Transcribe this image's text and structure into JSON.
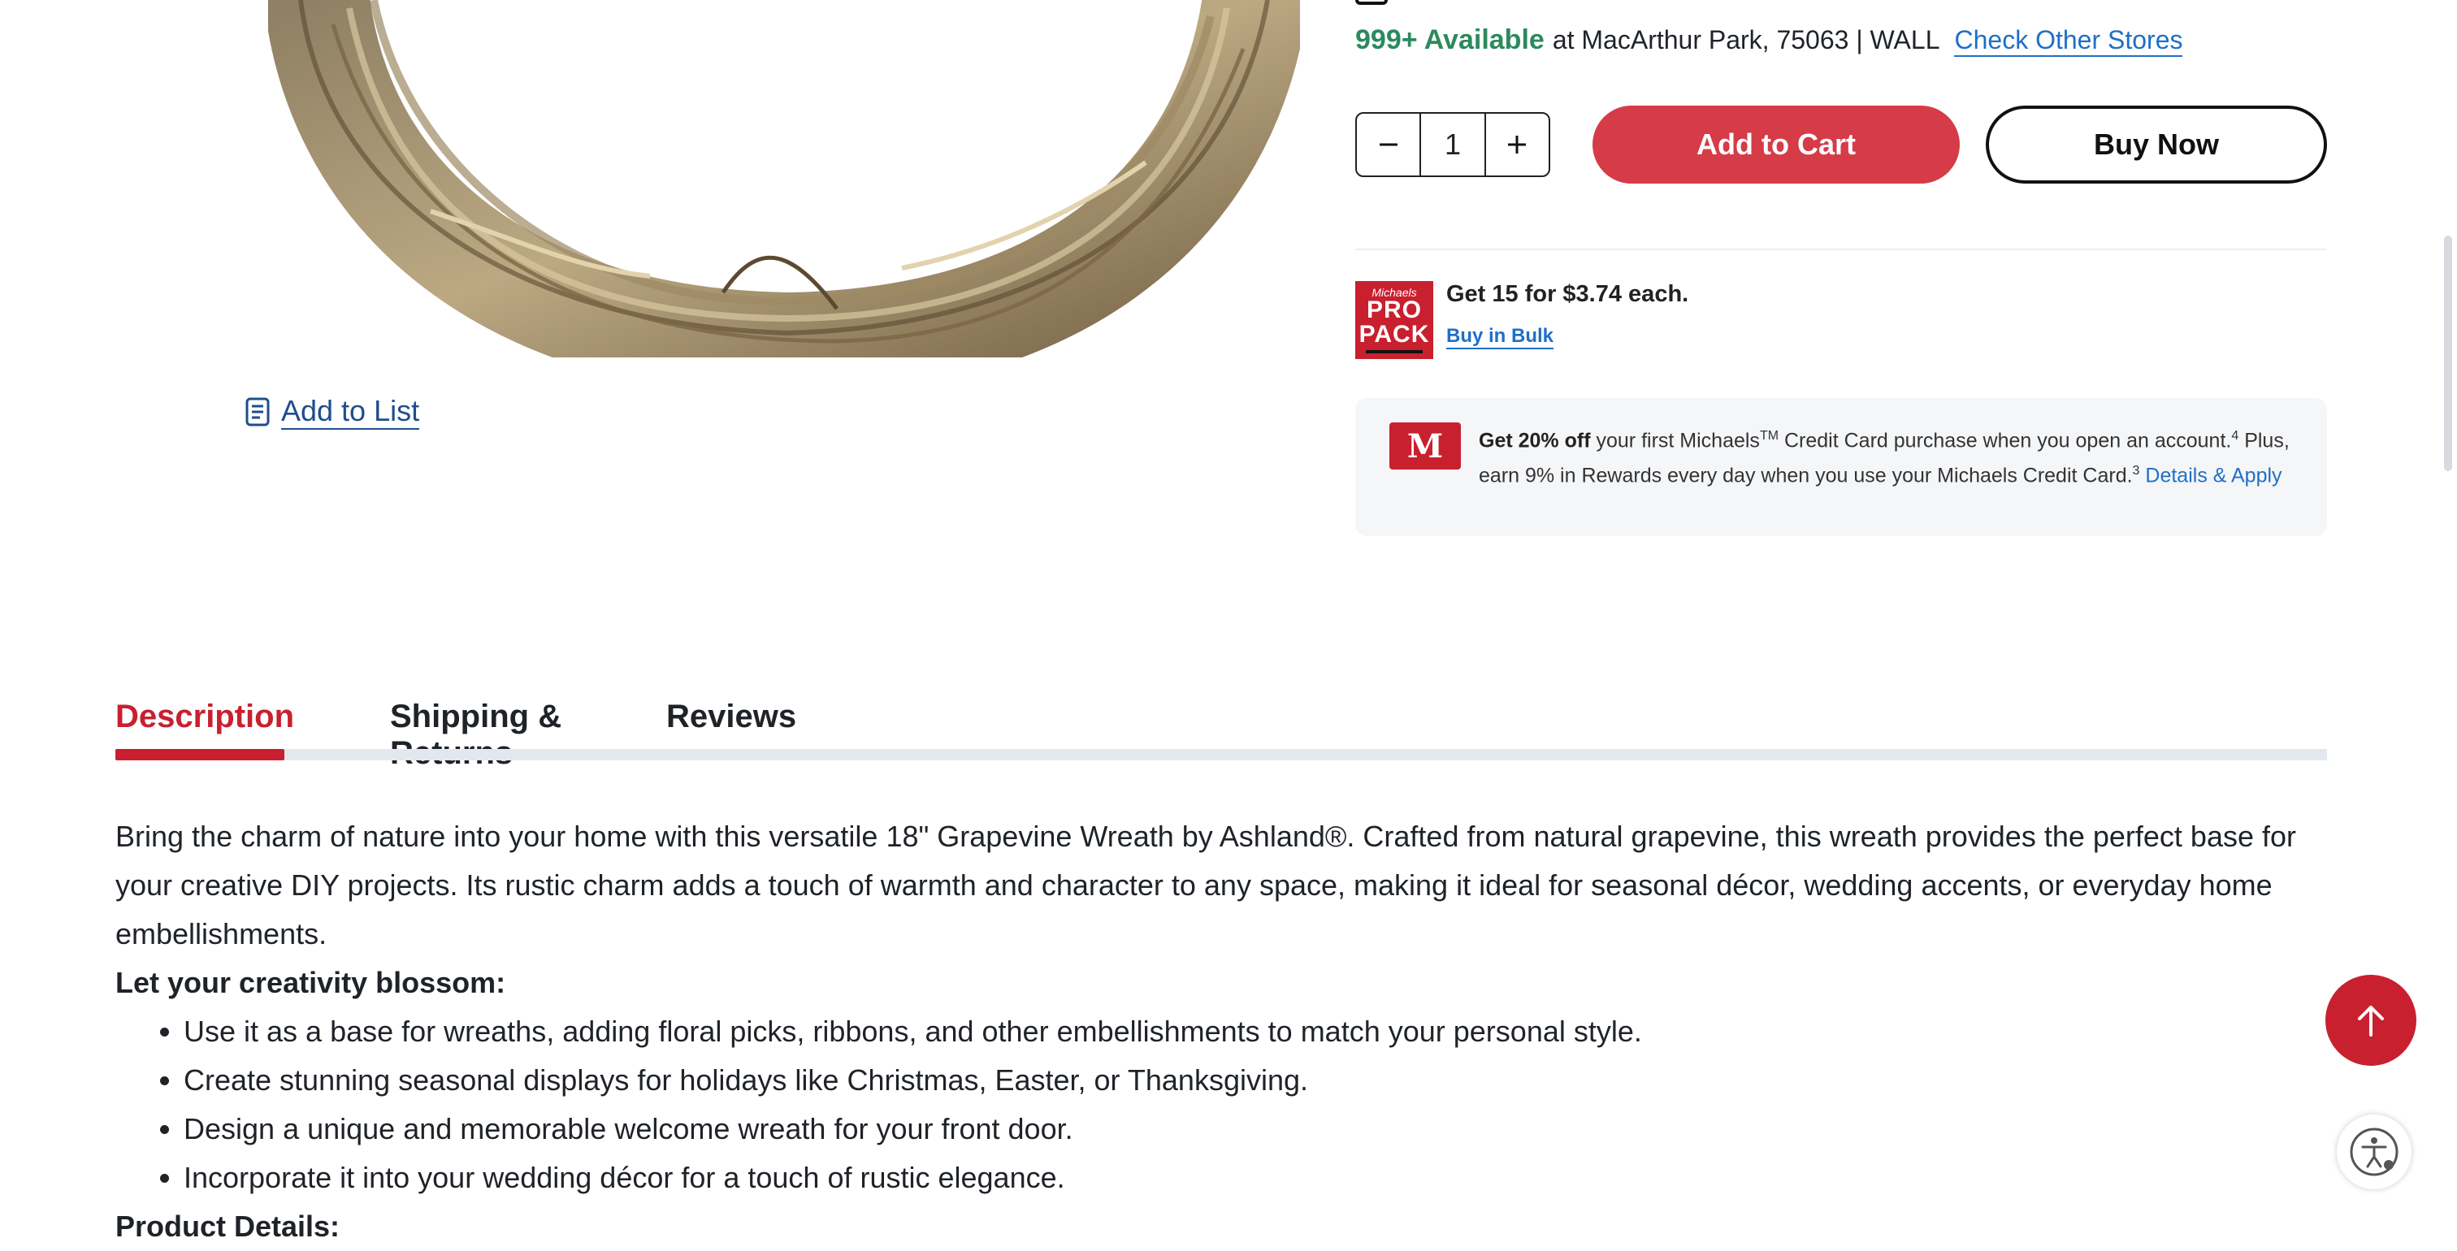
{
  "product": {
    "add_to_list_label": "Add to List"
  },
  "availability": {
    "count": "999+ Available",
    "store_text": "at MacArthur Park, 75063 | WALL",
    "check_other_stores": "Check Other Stores"
  },
  "purchase": {
    "quantity": "1",
    "add_to_cart": "Add to Cart",
    "buy_now": "Buy Now"
  },
  "pro_pack": {
    "logo_script": "Michaels",
    "logo_line1": "PRO",
    "logo_line2": "PACK",
    "offer": "Get 15 for $3.74 each.",
    "bulk_link": "Buy in Bulk"
  },
  "credit_card": {
    "card_letter": "M",
    "bold_offer": "Get 20% off",
    "text1": "your first Michaels",
    "tm": "TM",
    "text2": "Credit Card purchase when you open an account.",
    "sup1": "4",
    "text3": "Plus, earn 9% in Rewards every day when you use your Michaels Credit Card.",
    "sup2": "3",
    "link": "Details & Apply"
  },
  "tabs": {
    "description": "Description",
    "shipping": "Shipping & Returns",
    "reviews": "Reviews",
    "active": "Description"
  },
  "description": {
    "paragraph": "Bring the charm of nature into your home with this versatile 18\" Grapevine Wreath by Ashland®. Crafted from natural grapevine, this wreath provides the perfect base for your creative DIY projects. Its rustic charm adds a touch of warmth and character to any space, making it ideal for seasonal décor, wedding accents, or everyday home embellishments.",
    "heading1": "Let your creativity blossom:",
    "bullets": [
      "Use it as a base for wreaths, adding floral picks, ribbons, and other embellishments to match your personal style.",
      "Create stunning seasonal displays for holidays like Christmas, Easter, or Thanksgiving.",
      "Design a unique and memorable welcome wreath for your front door.",
      "Incorporate it into your wedding décor for a touch of rustic elegance."
    ],
    "heading2": "Product Details:"
  },
  "colors": {
    "brand_red": "#c8202f",
    "link_blue": "#1f6fc8",
    "available_green": "#2c8a5e"
  },
  "icons": [
    "list-icon",
    "minus-icon",
    "plus-icon",
    "arrow-up-icon",
    "accessibility-icon"
  ]
}
